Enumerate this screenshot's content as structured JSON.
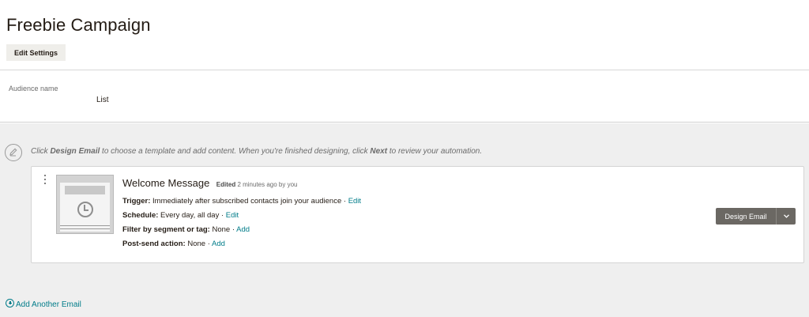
{
  "page": {
    "title": "Freebie Campaign",
    "edit_settings_label": "Edit Settings"
  },
  "audience": {
    "label": "Audience name",
    "value": "List"
  },
  "hint": {
    "pre": "Click ",
    "design_email": "Design Email",
    "mid": " to choose a template and add content. When you're finished designing, click ",
    "next": "Next",
    "post": " to review your automation."
  },
  "email": {
    "name": "Welcome Message",
    "edited_status": "Edited",
    "edited_time": " 2 minutes ago by you",
    "trigger_label": "Trigger:",
    "trigger_value": " Immediately after subscribed contacts join your audience",
    "schedule_label": "Schedule:",
    "schedule_value": " Every day, all day",
    "filter_label": "Filter by segment or tag:",
    "filter_value": " None",
    "post_send_label": "Post-send action:",
    "post_send_value": " None",
    "separator": " · ",
    "edit_link": "Edit",
    "add_link": "Add",
    "design_button": "Design Email"
  },
  "footer": {
    "add_another_label": "Add Another Email"
  },
  "colors": {
    "link": "#007c89",
    "button": "#6b6863",
    "workspace_bg": "#efefef"
  }
}
